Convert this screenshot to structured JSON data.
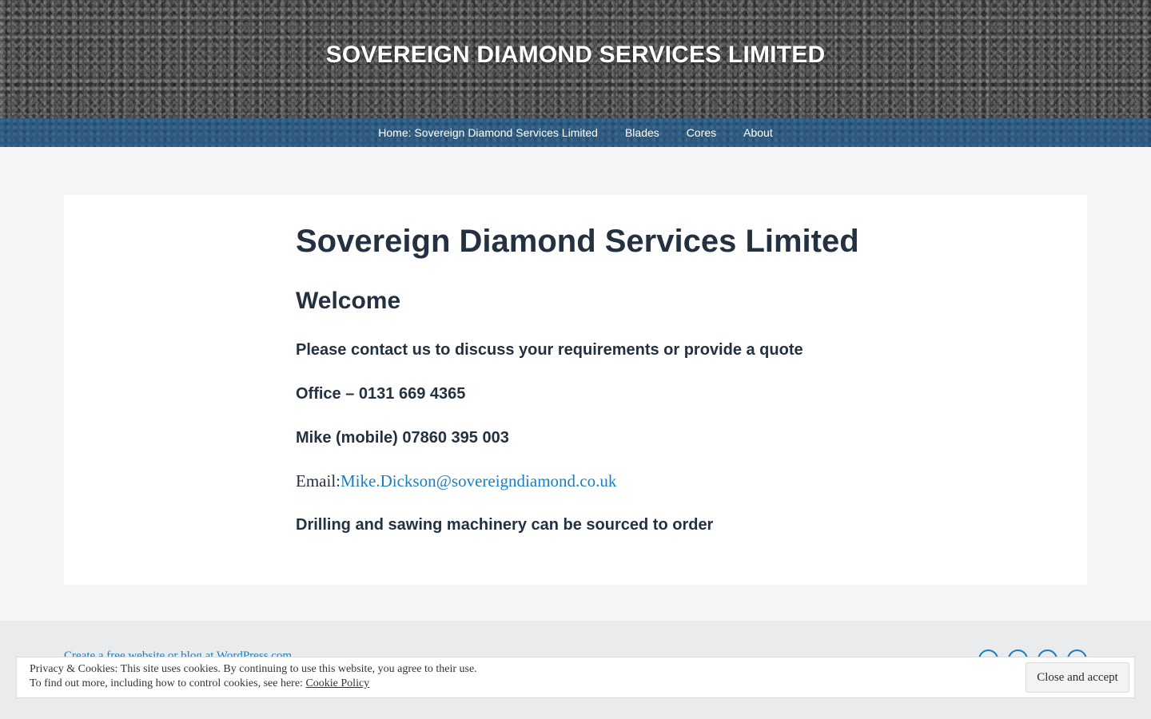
{
  "header": {
    "site_title": "SOVEREIGN DIAMOND SERVICES LIMITED"
  },
  "nav": {
    "items": [
      {
        "label": "Home: Sovereign Diamond Services Limited"
      },
      {
        "label": "Blades"
      },
      {
        "label": "Cores"
      },
      {
        "label": "About"
      }
    ]
  },
  "content": {
    "page_title": "Sovereign Diamond Services Limited",
    "welcome": "Welcome",
    "contact_line": "Please contact us to discuss your requirements or provide a quote",
    "office_line": "Office – 0131 669 4365",
    "mobile_line": "Mike (mobile) 07860 395 003",
    "email_label": "Email:",
    "email_address": "Mike.Dickson@sovereigndiamond.co.uk",
    "machinery_line": "Drilling and sawing machinery can be sourced to order"
  },
  "footer": {
    "credit_link": "Create a free website or blog at WordPress.com"
  },
  "cookie_banner": {
    "line1": "Privacy & Cookies: This site uses cookies. By continuing to use this website, you agree to their use.",
    "line2_prefix": "To find out more, including how to control cookies, see here: ",
    "policy_link": "Cookie Policy",
    "close_button": "Close and accept"
  },
  "colors": {
    "nav_bar": "#2c5a80",
    "link": "#1a7fc1",
    "heading_text": "#233140"
  }
}
